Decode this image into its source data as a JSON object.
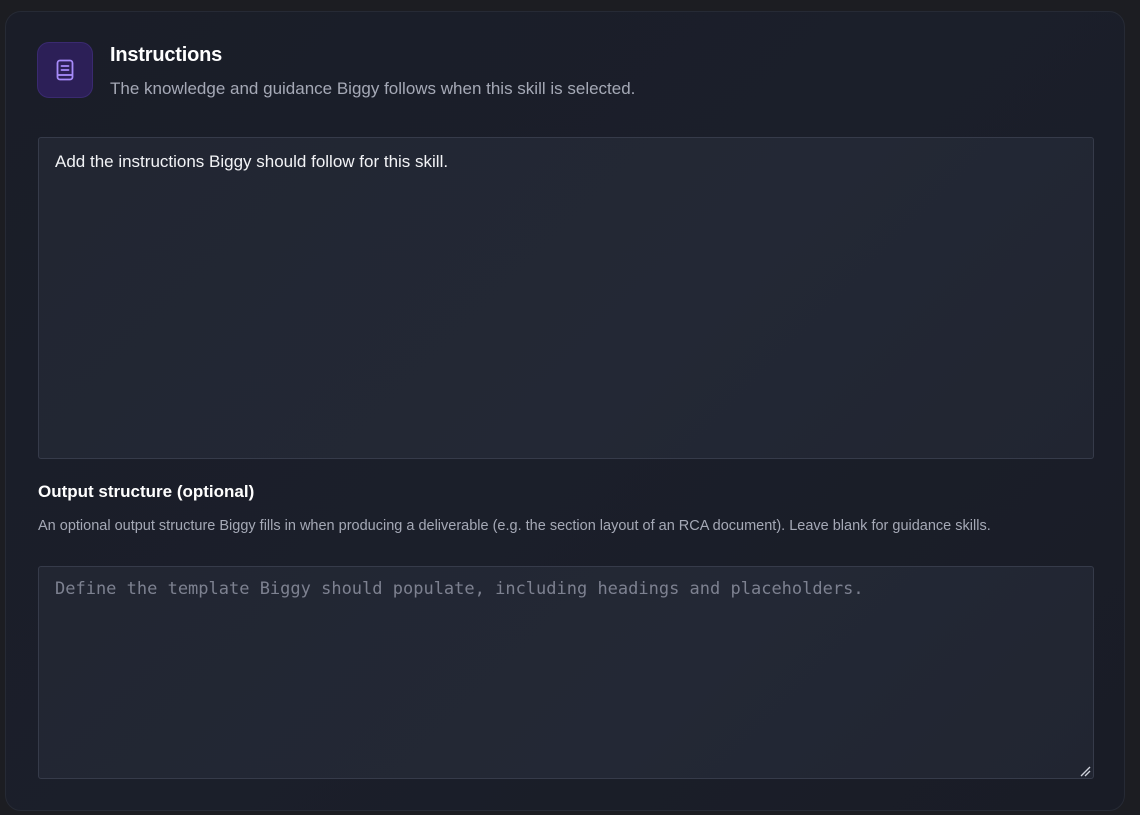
{
  "header": {
    "icon": "document-icon",
    "title": "Instructions",
    "subtitle": "The knowledge and guidance Biggy follows when this skill is selected."
  },
  "instructions": {
    "value": "Add the instructions Biggy should follow for this skill."
  },
  "output_structure": {
    "label": "Output structure (optional)",
    "description": "An optional output structure Biggy fills in when producing a deliverable (e.g. the section layout of an RCA document). Leave blank for guidance skills.",
    "placeholder": "Define the template Biggy should populate, including headings and placeholders."
  },
  "colors": {
    "accent": "#a78bfa",
    "icon_tile_bg": "#2c1f57",
    "card_bg": "#1a1d28",
    "input_bg": "#222632"
  }
}
